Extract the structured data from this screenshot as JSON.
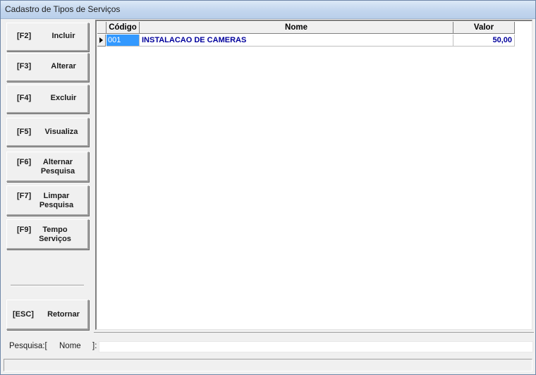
{
  "window": {
    "title": "Cadastro de Tipos de Serviços"
  },
  "buttons": [
    {
      "key": "[F2]",
      "label": "Incluir"
    },
    {
      "key": "[F3]",
      "label": "Alterar"
    },
    {
      "key": "[F4]",
      "label": "Excluir"
    },
    {
      "key": "[F5]",
      "label": "Visualiza"
    },
    {
      "key": "[F6]",
      "label_line1": "Alternar",
      "label_line2": "Pesquisa"
    },
    {
      "key": "[F7]",
      "label_line1": "Limpar",
      "label_line2": "Pesquisa"
    },
    {
      "key": "[F9]",
      "label_line1": "Tempo",
      "label_line2": "Serviços"
    },
    {
      "key": "[ESC]",
      "label": "Retornar"
    }
  ],
  "grid": {
    "columns": [
      "Código",
      "Nome",
      "Valor"
    ],
    "rows": [
      {
        "codigo": "001",
        "nome": "INSTALACAO DE CAMERAS",
        "valor": "50,00",
        "selected": true
      }
    ],
    "text_color": "#00009c",
    "selection_color": "#3399ff"
  },
  "search": {
    "prefix": "Pesquisa:[",
    "field": "Nome",
    "suffix": "]:",
    "value": ""
  }
}
